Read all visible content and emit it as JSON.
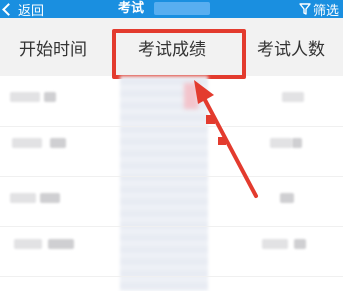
{
  "header": {
    "back_label": "返回",
    "title": "考试",
    "filter_label": "筛选"
  },
  "columns": [
    {
      "label": "开始时间"
    },
    {
      "label": "考试成绩"
    },
    {
      "label": "考试人数"
    }
  ],
  "colors": {
    "header_bg": "#1a8fe0",
    "column_header_bg": "#f2f2f2",
    "annotation_red": "#e33b2e"
  },
  "icons": {
    "back": "chevron-left-icon",
    "filter": "funnel-icon"
  }
}
